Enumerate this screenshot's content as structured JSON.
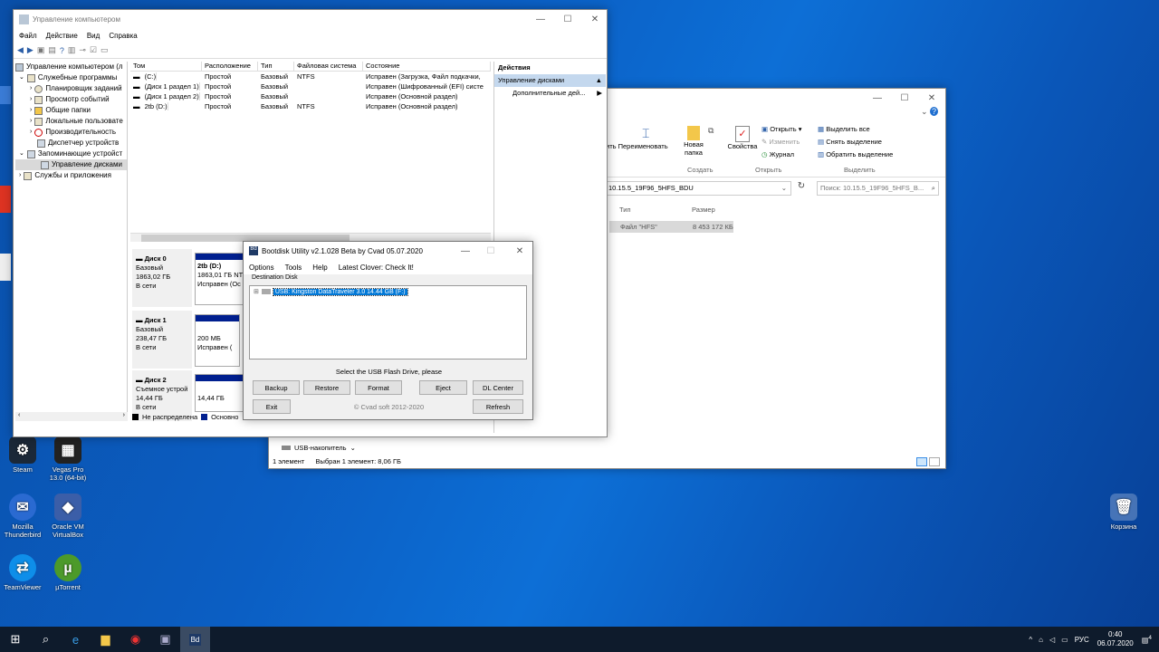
{
  "desktop": {
    "icons": [
      {
        "label": "Steam"
      },
      {
        "label": "Vegas Pro 13.0 (64-bit)"
      },
      {
        "label": "Mozilla Thunderbird"
      },
      {
        "label": "Oracle VM VirtualBox"
      },
      {
        "label": "TeamViewer"
      },
      {
        "label": "µTorrent"
      },
      {
        "label": "Корзина"
      }
    ]
  },
  "compmgmt": {
    "title": "Управление компьютером",
    "menu": [
      "Файл",
      "Действие",
      "Вид",
      "Справка"
    ],
    "tree": [
      {
        "label": "Управление компьютером (л"
      },
      {
        "label": "Служебные программы"
      },
      {
        "label": "Планировщик заданий"
      },
      {
        "label": "Просмотр событий"
      },
      {
        "label": "Общие папки"
      },
      {
        "label": "Локальные пользовате"
      },
      {
        "label": "Производительность"
      },
      {
        "label": "Диспетчер устройств"
      },
      {
        "label": "Запоминающие устройст"
      },
      {
        "label": "Управление дисками"
      },
      {
        "label": "Службы и приложения"
      }
    ],
    "columns": [
      "Том",
      "Расположение",
      "Тип",
      "Файловая система",
      "Состояние"
    ],
    "volumes": [
      [
        "(C:)",
        "Простой",
        "Базовый",
        "NTFS",
        "Исправен (Загрузка, Файл подкачки,"
      ],
      [
        "(Диск 1 раздел 1)",
        "Простой",
        "Базовый",
        "",
        "Исправен (Шифрованный (EFI) систе"
      ],
      [
        "(Диск 1 раздел 2)",
        "Простой",
        "Базовый",
        "",
        "Исправен (Основной раздел)"
      ],
      [
        "2tb (D:)",
        "Простой",
        "Базовый",
        "NTFS",
        "Исправен (Основной раздел)"
      ]
    ],
    "disks": [
      {
        "name": "Диск 0",
        "type": "Базовый",
        "size": "1863,02 ГБ",
        "status": "В сети",
        "part_title": "2tb  (D:)",
        "part_size": "1863,01 ГБ NT",
        "part_status": "Исправен (Ос"
      },
      {
        "name": "Диск 1",
        "type": "Базовый",
        "size": "238,47 ГБ",
        "status": "В сети",
        "part_title": "",
        "part_size": "200 МБ",
        "part_status": "Исправен ("
      },
      {
        "name": "Диск 2",
        "type": "Съемное устрой",
        "size": "14,44 ГБ",
        "status": "В сети",
        "part_title": "",
        "part_size": "14,44 ГБ",
        "part_status": ""
      }
    ],
    "legend": [
      "Не распределена",
      "Основно"
    ],
    "actions_title": "Действия",
    "actions_section": "Управление дисками",
    "actions_more": "Дополнительные дей..."
  },
  "explorer": {
    "ribbon": {
      "rename": "ить  Переименовать",
      "new_folder": "Новая папка",
      "props": "Свойства",
      "open": "Открыть",
      "edit": "Изменить",
      "history": "Журнал",
      "select_all": "Выделить все",
      "select_none": "Снять выделение",
      "invert": "Обратить выделение",
      "grp_create": "Создать",
      "grp_open": "Открыть",
      "grp_select": "Выделить"
    },
    "path": "10.15.5_19F96_5HFS_BDU",
    "search_placeholder": "Поиск: 10.15.5_19F96_5HFS_B...",
    "col_type": "Тип",
    "col_size": "Размер",
    "file_type": "Файл \"HFS\"",
    "file_size": "8 453 172 КБ",
    "nav_item": "USB-накопитель",
    "status_count": "1 элемент",
    "status_sel": "Выбран 1 элемент: 8,06 ГБ"
  },
  "bdu": {
    "title": "Bootdisk Utility v2.1.028 Beta by Cvad 05.07.2020",
    "menu": [
      "Options",
      "Tools",
      "Help",
      "Latest Clover: Check It!"
    ],
    "dest_label": "Destination Disk",
    "disk_item": "USB: Kingston DataTraveler 3.0 14.44 GB (F:)",
    "hint": "Select the USB Flash Drive, please",
    "buttons": {
      "backup": "Backup",
      "restore": "Restore",
      "format": "Format",
      "eject": "Eject",
      "dl": "DL Center",
      "exit": "Exit",
      "refresh": "Refresh"
    },
    "copyright": "© Cvad soft 2012-2020"
  },
  "taskbar": {
    "lang": "РУС",
    "time": "0:40",
    "date": "06.07.2020",
    "notif_count": "4"
  }
}
